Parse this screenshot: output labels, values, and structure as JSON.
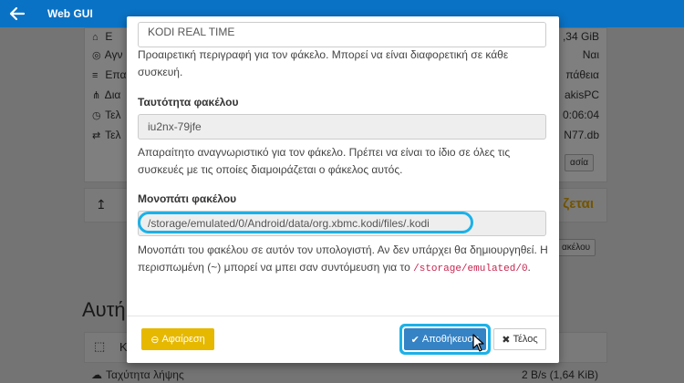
{
  "topbar": {
    "title": "Web GUI"
  },
  "background": {
    "rows": [
      {
        "icon": "⌂",
        "label": "Ε",
        "value": ",34 GiB"
      },
      {
        "icon": "◎",
        "label": "Αγν",
        "value": "Ναι"
      },
      {
        "icon": "≡",
        "label": "Επα",
        "value": "πάθεια"
      },
      {
        "icon": "⋔",
        "label": "Δια",
        "value": "akisPC"
      },
      {
        "icon": "◷",
        "label": "Τελ",
        "value": "0:06:04"
      },
      {
        "icon": "⇄",
        "label": "Τελ",
        "value": "N77.db"
      }
    ],
    "edit_btn": "ασία",
    "section2_value": "ζεται",
    "section2_btn": "ακέλου",
    "heading": "Αυτή",
    "section3_label": "Κ",
    "bottom_label": "Ταχύτητα λήψης",
    "bottom_value": "2 B/s (1,64 KiB)"
  },
  "modal": {
    "label_value": "KODI REAL TIME",
    "label_help": "Προαιρετική περιγραφή για τον φάκελο. Μπορεί να είναι διαφορετική σε κάθε συσκευή.",
    "id_label": "Ταυτότητα φακέλου",
    "id_value": "iu2nx-79jfe",
    "id_help": "Απαραίτητο αναγνωριστικό για τον φάκελο. Πρέπει να είναι το ίδιο σε όλες τις συσκευές με τις οποίες διαμοιράζεται ο φάκελος αυτός.",
    "path_label": "Μονοπάτι φακέλου",
    "path_value": "/storage/emulated/0/Android/data/org.xbmc.kodi/files/.kodi",
    "path_help": "Μονοπάτι του φακέλου σε αυτόν τον υπολογιστή. Αν δεν υπάρχει θα δημιουργηθεί. Η περισπωμένη (~) μπορεί να μπει σαν συντόμευση για το",
    "path_help_code": "/storage/emulated/0",
    "path_help_end": ".",
    "remove_label": "Αφαίρεση",
    "save_label": "Αποθήκευση",
    "close_label": "Τέλος"
  },
  "colors": {
    "topbar": "#0a72c4",
    "save": "#3582c4",
    "remove": "#e6b800",
    "highlight": "#1cb1e8"
  }
}
